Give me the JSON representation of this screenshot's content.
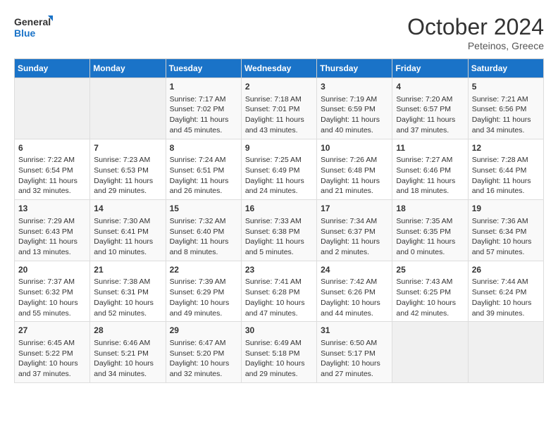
{
  "logo": {
    "line1": "General",
    "line2": "Blue"
  },
  "title": "October 2024",
  "subtitle": "Peteinos, Greece",
  "days_of_week": [
    "Sunday",
    "Monday",
    "Tuesday",
    "Wednesday",
    "Thursday",
    "Friday",
    "Saturday"
  ],
  "weeks": [
    [
      {
        "day": "",
        "empty": true
      },
      {
        "day": "",
        "empty": true
      },
      {
        "day": "1",
        "sunrise": "Sunrise: 7:17 AM",
        "sunset": "Sunset: 7:02 PM",
        "daylight": "Daylight: 11 hours and 45 minutes."
      },
      {
        "day": "2",
        "sunrise": "Sunrise: 7:18 AM",
        "sunset": "Sunset: 7:01 PM",
        "daylight": "Daylight: 11 hours and 43 minutes."
      },
      {
        "day": "3",
        "sunrise": "Sunrise: 7:19 AM",
        "sunset": "Sunset: 6:59 PM",
        "daylight": "Daylight: 11 hours and 40 minutes."
      },
      {
        "day": "4",
        "sunrise": "Sunrise: 7:20 AM",
        "sunset": "Sunset: 6:57 PM",
        "daylight": "Daylight: 11 hours and 37 minutes."
      },
      {
        "day": "5",
        "sunrise": "Sunrise: 7:21 AM",
        "sunset": "Sunset: 6:56 PM",
        "daylight": "Daylight: 11 hours and 34 minutes."
      }
    ],
    [
      {
        "day": "6",
        "sunrise": "Sunrise: 7:22 AM",
        "sunset": "Sunset: 6:54 PM",
        "daylight": "Daylight: 11 hours and 32 minutes."
      },
      {
        "day": "7",
        "sunrise": "Sunrise: 7:23 AM",
        "sunset": "Sunset: 6:53 PM",
        "daylight": "Daylight: 11 hours and 29 minutes."
      },
      {
        "day": "8",
        "sunrise": "Sunrise: 7:24 AM",
        "sunset": "Sunset: 6:51 PM",
        "daylight": "Daylight: 11 hours and 26 minutes."
      },
      {
        "day": "9",
        "sunrise": "Sunrise: 7:25 AM",
        "sunset": "Sunset: 6:49 PM",
        "daylight": "Daylight: 11 hours and 24 minutes."
      },
      {
        "day": "10",
        "sunrise": "Sunrise: 7:26 AM",
        "sunset": "Sunset: 6:48 PM",
        "daylight": "Daylight: 11 hours and 21 minutes."
      },
      {
        "day": "11",
        "sunrise": "Sunrise: 7:27 AM",
        "sunset": "Sunset: 6:46 PM",
        "daylight": "Daylight: 11 hours and 18 minutes."
      },
      {
        "day": "12",
        "sunrise": "Sunrise: 7:28 AM",
        "sunset": "Sunset: 6:44 PM",
        "daylight": "Daylight: 11 hours and 16 minutes."
      }
    ],
    [
      {
        "day": "13",
        "sunrise": "Sunrise: 7:29 AM",
        "sunset": "Sunset: 6:43 PM",
        "daylight": "Daylight: 11 hours and 13 minutes."
      },
      {
        "day": "14",
        "sunrise": "Sunrise: 7:30 AM",
        "sunset": "Sunset: 6:41 PM",
        "daylight": "Daylight: 11 hours and 10 minutes."
      },
      {
        "day": "15",
        "sunrise": "Sunrise: 7:32 AM",
        "sunset": "Sunset: 6:40 PM",
        "daylight": "Daylight: 11 hours and 8 minutes."
      },
      {
        "day": "16",
        "sunrise": "Sunrise: 7:33 AM",
        "sunset": "Sunset: 6:38 PM",
        "daylight": "Daylight: 11 hours and 5 minutes."
      },
      {
        "day": "17",
        "sunrise": "Sunrise: 7:34 AM",
        "sunset": "Sunset: 6:37 PM",
        "daylight": "Daylight: 11 hours and 2 minutes."
      },
      {
        "day": "18",
        "sunrise": "Sunrise: 7:35 AM",
        "sunset": "Sunset: 6:35 PM",
        "daylight": "Daylight: 11 hours and 0 minutes."
      },
      {
        "day": "19",
        "sunrise": "Sunrise: 7:36 AM",
        "sunset": "Sunset: 6:34 PM",
        "daylight": "Daylight: 10 hours and 57 minutes."
      }
    ],
    [
      {
        "day": "20",
        "sunrise": "Sunrise: 7:37 AM",
        "sunset": "Sunset: 6:32 PM",
        "daylight": "Daylight: 10 hours and 55 minutes."
      },
      {
        "day": "21",
        "sunrise": "Sunrise: 7:38 AM",
        "sunset": "Sunset: 6:31 PM",
        "daylight": "Daylight: 10 hours and 52 minutes."
      },
      {
        "day": "22",
        "sunrise": "Sunrise: 7:39 AM",
        "sunset": "Sunset: 6:29 PM",
        "daylight": "Daylight: 10 hours and 49 minutes."
      },
      {
        "day": "23",
        "sunrise": "Sunrise: 7:41 AM",
        "sunset": "Sunset: 6:28 PM",
        "daylight": "Daylight: 10 hours and 47 minutes."
      },
      {
        "day": "24",
        "sunrise": "Sunrise: 7:42 AM",
        "sunset": "Sunset: 6:26 PM",
        "daylight": "Daylight: 10 hours and 44 minutes."
      },
      {
        "day": "25",
        "sunrise": "Sunrise: 7:43 AM",
        "sunset": "Sunset: 6:25 PM",
        "daylight": "Daylight: 10 hours and 42 minutes."
      },
      {
        "day": "26",
        "sunrise": "Sunrise: 7:44 AM",
        "sunset": "Sunset: 6:24 PM",
        "daylight": "Daylight: 10 hours and 39 minutes."
      }
    ],
    [
      {
        "day": "27",
        "sunrise": "Sunrise: 6:45 AM",
        "sunset": "Sunset: 5:22 PM",
        "daylight": "Daylight: 10 hours and 37 minutes."
      },
      {
        "day": "28",
        "sunrise": "Sunrise: 6:46 AM",
        "sunset": "Sunset: 5:21 PM",
        "daylight": "Daylight: 10 hours and 34 minutes."
      },
      {
        "day": "29",
        "sunrise": "Sunrise: 6:47 AM",
        "sunset": "Sunset: 5:20 PM",
        "daylight": "Daylight: 10 hours and 32 minutes."
      },
      {
        "day": "30",
        "sunrise": "Sunrise: 6:49 AM",
        "sunset": "Sunset: 5:18 PM",
        "daylight": "Daylight: 10 hours and 29 minutes."
      },
      {
        "day": "31",
        "sunrise": "Sunrise: 6:50 AM",
        "sunset": "Sunset: 5:17 PM",
        "daylight": "Daylight: 10 hours and 27 minutes."
      },
      {
        "day": "",
        "empty": true
      },
      {
        "day": "",
        "empty": true
      }
    ]
  ]
}
